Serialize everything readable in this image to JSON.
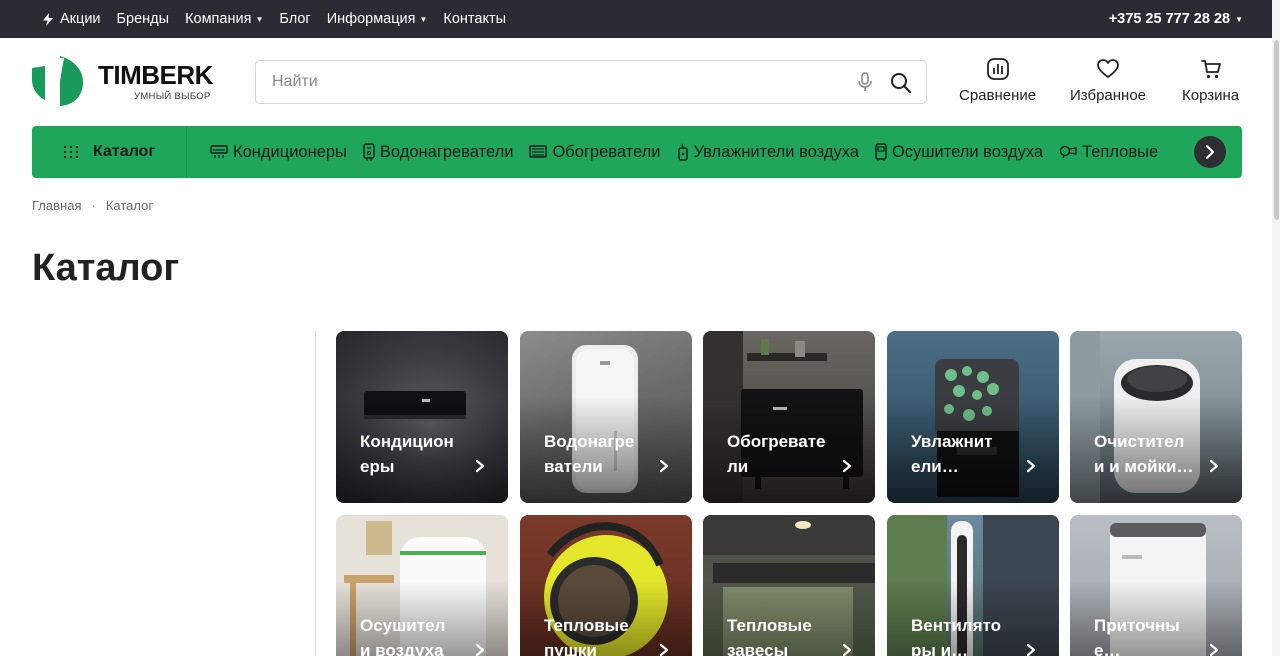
{
  "topnav": {
    "items": [
      {
        "label": "Акции",
        "has_icon": "bolt-icon"
      },
      {
        "label": "Бренды"
      },
      {
        "label": "Компания",
        "dropdown": true
      },
      {
        "label": "Блог"
      },
      {
        "label": "Информация",
        "dropdown": true
      },
      {
        "label": "Контакты"
      }
    ],
    "phone": "+375 25 777 28 28"
  },
  "logo": {
    "name": "TIMBERK",
    "tagline": "УМНЫЙ ВЫБОР"
  },
  "search": {
    "placeholder": "Найти",
    "value": ""
  },
  "header_buttons": {
    "compare": "Сравнение",
    "favorites": "Избранное",
    "cart": "Корзина"
  },
  "catalog_bar": {
    "catalog_label": "Каталог",
    "items": [
      {
        "label": "Кондиционеры",
        "icon": "air-conditioner-icon"
      },
      {
        "label": "Водонагреватели",
        "icon": "water-heater-icon"
      },
      {
        "label": "Обогреватели",
        "icon": "heater-icon"
      },
      {
        "label": "Увлажнители воздуха",
        "icon": "humidifier-icon"
      },
      {
        "label": "Осушители воздуха",
        "icon": "dehumidifier-icon"
      },
      {
        "label": "Тепловые",
        "icon": "heat-gun-icon"
      }
    ]
  },
  "breadcrumb": [
    "Главная",
    "Каталог"
  ],
  "page_title": "Каталог",
  "categories": [
    {
      "label": "Кондиционеры"
    },
    {
      "label": "Водонагреватели"
    },
    {
      "label": "Обогреватели"
    },
    {
      "label": "Увлажнит ели…"
    },
    {
      "label": "Очистител и и мойки…"
    },
    {
      "label": "Осушител и воздуха"
    },
    {
      "label": "Тепловые пушки"
    },
    {
      "label": "Тепловые завесы"
    },
    {
      "label": "Вентилято ры и…"
    },
    {
      "label": "Приточны е…"
    }
  ],
  "colors": {
    "topbar": "#2b2c33",
    "accent_green": "#1fa65a",
    "logo_green": "#1a9a5a"
  }
}
